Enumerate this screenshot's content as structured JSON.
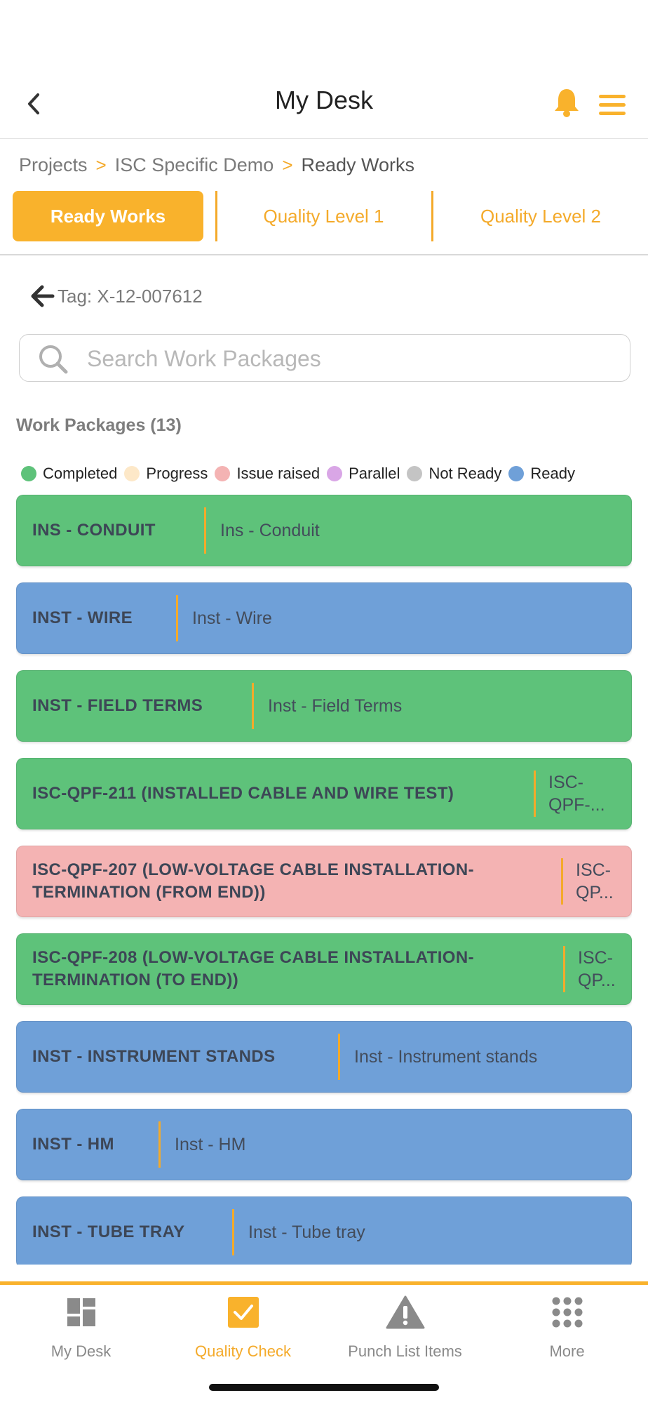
{
  "header": {
    "title": "My Desk",
    "back_icon": "chevron-left-icon",
    "bell_icon": "bell-icon",
    "menu_icon": "hamburger-menu-icon",
    "accent": "#f9b22c"
  },
  "breadcrumb": {
    "items": [
      "Projects",
      "ISC Specific Demo",
      "Ready Works"
    ],
    "separator": ">"
  },
  "tabs": [
    {
      "label": "Ready Works",
      "active": true
    },
    {
      "label": "Quality Level 1",
      "active": false
    },
    {
      "label": "Quality Level 2",
      "active": false
    }
  ],
  "tag": {
    "label": "Tag: X-12-007612"
  },
  "search": {
    "placeholder": "Search Work Packages",
    "value": ""
  },
  "work_packages": {
    "title": "Work Packages (13)"
  },
  "legend": [
    {
      "label": "Completed",
      "color": "#5ec27a"
    },
    {
      "label": "Progress",
      "color": "#fde8c8"
    },
    {
      "label": "Issue raised",
      "color": "#f4b3b3"
    },
    {
      "label": "Parallel",
      "color": "#d9a6e6"
    },
    {
      "label": "Not Ready",
      "color": "#c4c4c4"
    },
    {
      "label": "Ready",
      "color": "#6fa0d8"
    }
  ],
  "packages": [
    {
      "name": "INS - CONDUIT",
      "desc": "Ins - Conduit",
      "status": "Completed",
      "color": "#5ec27a"
    },
    {
      "name": "INST - WIRE",
      "desc": "Inst - Wire",
      "status": "Ready",
      "color": "#6fa0d8"
    },
    {
      "name": "INST - FIELD TERMS",
      "desc": "Inst - Field Terms",
      "status": "Completed",
      "color": "#5ec27a"
    },
    {
      "name": "ISC-QPF-211 (INSTALLED CABLE AND WIRE TEST)",
      "desc": "ISC-QPF-...",
      "status": "Completed",
      "color": "#5ec27a"
    },
    {
      "name": "ISC-QPF-207 (LOW-VOLTAGE CABLE INSTALLATION-TERMINATION (FROM END))",
      "desc": "ISC-QP...",
      "status": "Issue raised",
      "color": "#f4b3b3"
    },
    {
      "name": "ISC-QPF-208 (LOW-VOLTAGE CABLE INSTALLATION-TERMINATION (TO END))",
      "desc": "ISC-QP...",
      "status": "Completed",
      "color": "#5ec27a"
    },
    {
      "name": "INST - INSTRUMENT STANDS",
      "desc": "Inst - Instrument stands",
      "status": "Ready",
      "color": "#6fa0d8"
    },
    {
      "name": "INST - HM",
      "desc": "Inst - HM",
      "status": "Ready",
      "color": "#6fa0d8"
    },
    {
      "name": "INST - TUBE TRAY",
      "desc": "Inst - Tube tray",
      "status": "Ready",
      "color": "#6fa0d8"
    }
  ],
  "bottom_nav": [
    {
      "label": "My Desk",
      "icon": "dashboard-icon",
      "active": false
    },
    {
      "label": "Quality Check",
      "icon": "checkbox-icon",
      "active": true
    },
    {
      "label": "Punch List Items",
      "icon": "warning-icon",
      "active": false
    },
    {
      "label": "More",
      "icon": "grid-dots-icon",
      "active": false
    }
  ]
}
